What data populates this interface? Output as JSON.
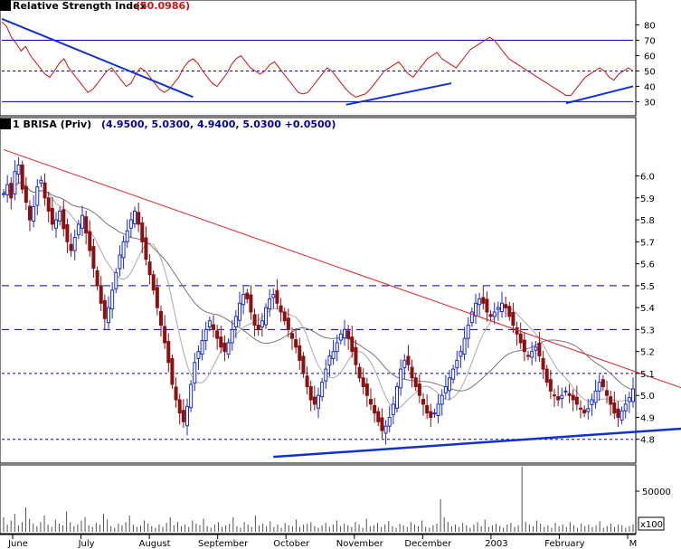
{
  "chart_data": [
    {
      "panel": "rsi",
      "type": "line",
      "title": "Relative Strength Index",
      "value_label": "(50.0986)",
      "ylim": [
        22,
        88
      ],
      "yticks": [
        30,
        40,
        50,
        60,
        70,
        80
      ],
      "reference_lines": [
        30,
        50,
        70
      ],
      "colors": {
        "line": "#d01010",
        "trend": "#1030d0",
        "ref": "#0000c0"
      },
      "series": [
        {
          "values": [
            82,
            79,
            72,
            68,
            63,
            66,
            60,
            56,
            52,
            48,
            46,
            50,
            55,
            58,
            52,
            48,
            44,
            40,
            36,
            38,
            42,
            46,
            50,
            52,
            48,
            44,
            40,
            42,
            48,
            52,
            50,
            46,
            42,
            38,
            36,
            38,
            42,
            46,
            52,
            56,
            58,
            55,
            50,
            46,
            42,
            40,
            44,
            48,
            54,
            58,
            60,
            56,
            52,
            50,
            48,
            50,
            54,
            56,
            52,
            48,
            44,
            40,
            36,
            35,
            36,
            40,
            44,
            48,
            52,
            50,
            46,
            42,
            38,
            35,
            33,
            34,
            35,
            38,
            42,
            46,
            50,
            52,
            54,
            56,
            52,
            48,
            46,
            50,
            54,
            58,
            60,
            62,
            58,
            56,
            54,
            52,
            56,
            60,
            64,
            66,
            68,
            70,
            72,
            70,
            66,
            62,
            58,
            56,
            54,
            52,
            50,
            48,
            46,
            44,
            42,
            40,
            38,
            36,
            34,
            34,
            38,
            42,
            46,
            48,
            50,
            52,
            50,
            46,
            44,
            48,
            50,
            52,
            50
          ]
        }
      ],
      "trendlines": [
        {
          "from": [
            0,
            84
          ],
          "to": [
            40,
            33
          ]
        },
        {
          "from": [
            72,
            28
          ],
          "to": [
            94,
            42
          ]
        },
        {
          "from": [
            118,
            29
          ],
          "to": [
            132,
            40
          ]
        }
      ]
    },
    {
      "panel": "price",
      "type": "candlestick",
      "title": "1 BRISA (Priv)",
      "ohlc_label": "(4.9500, 5.0300, 4.9400, 5.0300 +0.0500)",
      "ylim": [
        4.7,
        6.2
      ],
      "yticks": [
        4.8,
        4.9,
        5.0,
        5.1,
        5.2,
        5.3,
        5.4,
        5.5,
        5.6,
        5.7,
        5.8,
        5.9,
        6.0
      ],
      "horizontal_lines": [
        4.8,
        5.1,
        5.3,
        5.5
      ],
      "x_labels": [
        "June",
        "July",
        "August",
        "September",
        "October",
        "November",
        "December",
        "2003",
        "February",
        "M"
      ],
      "colors": {
        "up": "#1a2bd8",
        "down": "#8b1010",
        "ma_fast": "#aaaaaa",
        "ma_slow": "#777777",
        "resistance": "#e02020",
        "support": "#1030d0"
      },
      "series": [
        {
          "name": "close",
          "values": [
            5.92,
            5.96,
            5.9,
            6.02,
            6.05,
            5.94,
            5.88,
            5.8,
            5.86,
            5.95,
            5.98,
            5.9,
            5.84,
            5.78,
            5.8,
            5.84,
            5.76,
            5.7,
            5.66,
            5.72,
            5.78,
            5.82,
            5.74,
            5.66,
            5.58,
            5.5,
            5.42,
            5.35,
            5.4,
            5.48,
            5.56,
            5.64,
            5.7,
            5.75,
            5.8,
            5.84,
            5.78,
            5.7,
            5.62,
            5.55,
            5.48,
            5.4,
            5.32,
            5.24,
            5.15,
            5.05,
            4.98,
            4.92,
            4.88,
            4.95,
            5.05,
            5.15,
            5.2,
            5.25,
            5.3,
            5.34,
            5.3,
            5.26,
            5.22,
            5.2,
            5.24,
            5.3,
            5.36,
            5.42,
            5.46,
            5.44,
            5.38,
            5.32,
            5.3,
            5.34,
            5.4,
            5.44,
            5.46,
            5.42,
            5.38,
            5.34,
            5.3,
            5.26,
            5.22,
            5.16,
            5.1,
            5.04,
            4.98,
            4.96,
            5.0,
            5.06,
            5.12,
            5.18,
            5.2,
            5.24,
            5.28,
            5.3,
            5.26,
            5.2,
            5.14,
            5.08,
            5.04,
            5.0,
            4.96,
            4.92,
            4.88,
            4.84,
            4.86,
            4.9,
            4.96,
            5.04,
            5.12,
            5.16,
            5.14,
            5.08,
            5.04,
            5.0,
            4.96,
            4.92,
            4.9,
            4.92,
            4.96,
            5.0,
            5.04,
            5.08,
            5.12,
            5.16,
            5.2,
            5.26,
            5.32,
            5.38,
            5.42,
            5.44,
            5.42,
            5.38,
            5.36,
            5.38,
            5.4,
            5.42,
            5.4,
            5.36,
            5.32,
            5.28,
            5.24,
            5.2,
            5.18,
            5.2,
            5.22,
            5.18,
            5.12,
            5.06,
            5.02,
            5.0,
            4.98,
            5.0,
            5.02,
            5.0,
            4.98,
            4.96,
            4.94,
            4.92,
            4.94,
            4.98,
            5.02,
            5.06,
            5.04,
            5.0,
            4.96,
            4.92,
            4.9,
            4.93,
            4.96,
            4.99,
            5.03
          ]
        }
      ],
      "trendlines": [
        {
          "from": [
            0,
            6.12
          ],
          "to": [
            190,
            4.98
          ]
        },
        {
          "from": [
            72,
            4.72
          ],
          "to": [
            250,
            4.93
          ]
        }
      ]
    },
    {
      "panel": "volume",
      "type": "bar",
      "ylim": [
        0,
        80000
      ],
      "yticks": [
        50000
      ],
      "unit_label": "x100",
      "colors": {
        "bar": "#505050"
      },
      "values": [
        18000,
        9000,
        14000,
        22000,
        8000,
        12000,
        30000,
        16000,
        10000,
        7000,
        12000,
        20000,
        9000,
        6000,
        15000,
        10000,
        8000,
        25000,
        12000,
        7000,
        9000,
        14000,
        18000,
        8000,
        6000,
        11000,
        9000,
        22000,
        15000,
        7000,
        5000,
        10000,
        8000,
        12000,
        20000,
        9000,
        6000,
        8000,
        14000,
        10000,
        7000,
        5000,
        9000,
        6000,
        11000,
        18000,
        8000,
        12000,
        7000,
        9000,
        6000,
        14000,
        10000,
        8000,
        16000,
        7000,
        5000,
        9000,
        12000,
        6000,
        8000,
        10000,
        18000,
        7000,
        5000,
        12000,
        9000,
        6000,
        20000,
        8000,
        10000,
        7000,
        13000,
        6000,
        9000,
        5000,
        11000,
        8000,
        7000,
        15000,
        6000,
        9000,
        10000,
        12000,
        7000,
        5000,
        8000,
        11000,
        6000,
        9000,
        14000,
        7000,
        10000,
        8000,
        6000,
        12000,
        9000,
        5000,
        16000,
        7000,
        8000,
        11000,
        6000,
        9000,
        13000,
        7000,
        5000,
        10000,
        8000,
        6000,
        12000,
        9000,
        7000,
        14000,
        6000,
        5000,
        8000,
        10000,
        40000,
        18000,
        12000,
        7000,
        9000,
        6000,
        11000,
        8000,
        5000,
        9000,
        12000,
        7000,
        15000,
        6000,
        8000,
        10000,
        7000,
        5000,
        9000,
        11000,
        6000,
        8000,
        80000,
        12000,
        9000,
        7000,
        14000,
        10000,
        6000,
        8000,
        5000,
        11000,
        7000,
        9000,
        6000,
        12000,
        8000,
        5000,
        10000,
        7000,
        9000,
        6000,
        8000,
        13000,
        5000,
        7000,
        10000,
        6000,
        9000,
        8000,
        5000,
        7000,
        9000
      ]
    }
  ]
}
